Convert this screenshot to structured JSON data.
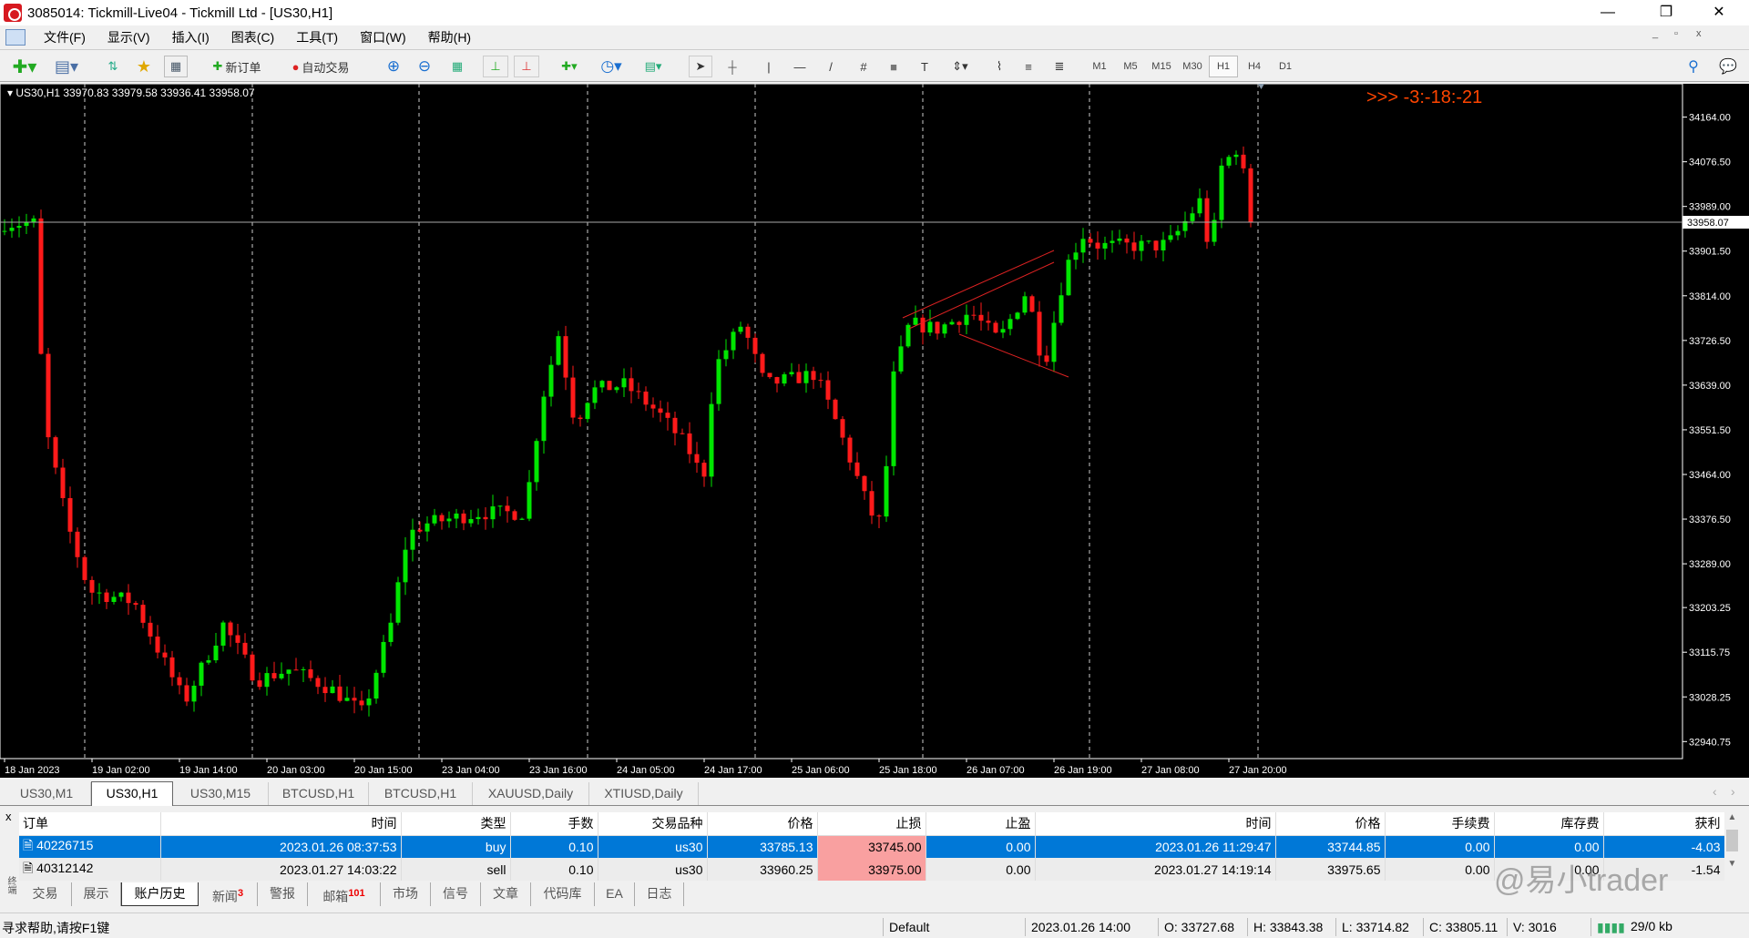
{
  "window": {
    "title": "3085014: Tickmill-Live04 - Tickmill Ltd - [US30,H1]",
    "min": "—",
    "max": "❐",
    "close": "✕"
  },
  "menu": [
    "文件(F)",
    "显示(V)",
    "插入(I)",
    "图表(C)",
    "工具(T)",
    "窗口(W)",
    "帮助(H)"
  ],
  "toolbar": {
    "new_order": "新订单",
    "auto_trading": "自动交易",
    "timeframes": [
      "M1",
      "M5",
      "M15",
      "M30",
      "H1",
      "H4",
      "D1"
    ],
    "selected_timeframe": "H1"
  },
  "chart": {
    "info": "US30,H1  33970.83 33979.58 33936.41 33958.07",
    "countdown": ">>> -3:-18:-21",
    "current_price": "33958.07",
    "price_labels": [
      "34164.00",
      "34076.50",
      "33989.00",
      "33901.50",
      "33814.00",
      "33726.50",
      "33639.00",
      "33551.50",
      "33464.00",
      "33376.50",
      "33289.00",
      "33203.25",
      "33115.75",
      "33028.25",
      "32940.75"
    ],
    "time_labels": [
      "18 Jan 2023",
      "19 Jan 02:00",
      "19 Jan 14:00",
      "20 Jan 03:00",
      "20 Jan 15:00",
      "23 Jan 04:00",
      "23 Jan 16:00",
      "24 Jan 05:00",
      "24 Jan 17:00",
      "25 Jan 06:00",
      "25 Jan 18:00",
      "26 Jan 07:00",
      "26 Jan 19:00",
      "27 Jan 08:00",
      "27 Jan 20:00"
    ],
    "bull_color": "#00e600",
    "bear_color": "#ff1a1a",
    "countdown_color": "#ff4500"
  },
  "chart_data": {
    "type": "candlestick",
    "ylim": [
      32940.75,
      34164.0
    ],
    "close_path": [
      [
        0,
        33956
      ],
      [
        4,
        33956
      ],
      [
        5.5,
        33563
      ],
      [
        8.6,
        33367
      ],
      [
        11.6,
        33236
      ],
      [
        17.8,
        33214
      ],
      [
        24.7,
        33018
      ],
      [
        30,
        33170
      ],
      [
        34.6,
        33061
      ],
      [
        39.2,
        33083
      ],
      [
        45.3,
        33040
      ],
      [
        49.2,
        32996
      ],
      [
        53,
        33170
      ],
      [
        55.3,
        33345
      ],
      [
        57.6,
        33367
      ],
      [
        65.2,
        33389
      ],
      [
        71.4,
        33389
      ],
      [
        73.7,
        33607
      ],
      [
        76,
        33738
      ],
      [
        78.3,
        33563
      ],
      [
        80.5,
        33629
      ],
      [
        85.1,
        33640
      ],
      [
        89.7,
        33585
      ],
      [
        93.6,
        33520
      ],
      [
        95.9,
        33454
      ],
      [
        97.4,
        33672
      ],
      [
        101.2,
        33760
      ],
      [
        104.3,
        33640
      ],
      [
        111.2,
        33661
      ],
      [
        114.2,
        33563
      ],
      [
        118.8,
        33389
      ],
      [
        120.4,
        33367
      ],
      [
        121.9,
        33650
      ],
      [
        124.2,
        33760
      ],
      [
        128,
        33749
      ],
      [
        132.6,
        33782
      ],
      [
        136.4,
        33727
      ],
      [
        140.3,
        33825
      ],
      [
        142.6,
        33672
      ],
      [
        145.6,
        33869
      ],
      [
        147.9,
        33934
      ],
      [
        150.2,
        33912
      ],
      [
        158.7,
        33912
      ],
      [
        160.2,
        33923
      ],
      [
        164,
        33999
      ],
      [
        165.5,
        33891
      ],
      [
        167,
        34066
      ],
      [
        169.4,
        34109
      ],
      [
        171,
        33958
      ]
    ]
  },
  "chart_tabs": [
    "US30,M1",
    "US30,H1",
    "US30,M15",
    "BTCUSD,H1",
    "BTCUSD,H1",
    "XAUUSD,Daily",
    "XTIUSD,Daily"
  ],
  "terminal": {
    "columns": [
      "订单",
      "时间",
      "类型",
      "手数",
      "交易品种",
      "价格",
      "止损",
      "止盈",
      "时间",
      "价格",
      "手续费",
      "库存费",
      "获利"
    ],
    "rows": [
      [
        "40226715",
        "2023.01.26 08:37:53",
        "buy",
        "0.10",
        "us30",
        "33785.13",
        "33745.00",
        "0.00",
        "2023.01.26 11:29:47",
        "33744.85",
        "0.00",
        "0.00",
        "-4.03"
      ],
      [
        "40312142",
        "2023.01.27 14:03:22",
        "sell",
        "0.10",
        "us30",
        "33960.25",
        "33975.00",
        "0.00",
        "2023.01.27 14:19:14",
        "33975.65",
        "0.00",
        "0.00",
        "-1.54"
      ]
    ],
    "tabs": [
      {
        "label": "交易"
      },
      {
        "label": "展示"
      },
      {
        "label": "账户历史"
      },
      {
        "label": "新闻",
        "badge": "3"
      },
      {
        "label": "警报"
      },
      {
        "label": "邮箱",
        "badge": "101"
      },
      {
        "label": "市场"
      },
      {
        "label": "信号"
      },
      {
        "label": "文章"
      },
      {
        "label": "代码库"
      },
      {
        "label": "EA"
      },
      {
        "label": "日志"
      }
    ],
    "side_label": "终端"
  },
  "status": {
    "help": "寻求帮助,请按F1键",
    "profile": "Default",
    "datetime": "2023.01.26 14:00",
    "open": "O: 33727.68",
    "high": "H: 33843.38",
    "low": "L: 33714.82",
    "close": "C: 33805.11",
    "volume": "V: 3016",
    "traffic": "29/0 kb"
  },
  "watermark": "@易小trader"
}
